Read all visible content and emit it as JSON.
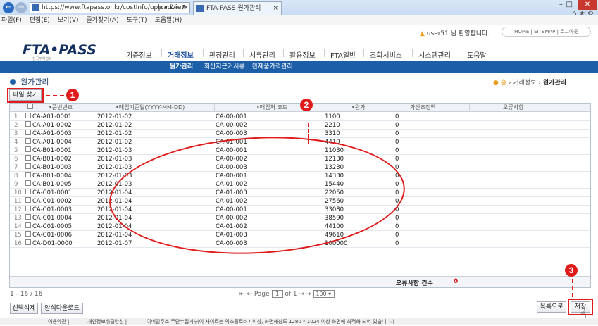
{
  "browser": {
    "url": "https://www.ftapass.or.kr/costInfo/uploadView",
    "url_icons": "ρ ▾ ▴ ≡ ↻",
    "tab_title": "FTA-PASS 원가관리",
    "tab_close": "×",
    "minimize": "–",
    "maximize": "□",
    "close": "✕",
    "toolbar_icons": "⌂ ★ ⚙",
    "back": "←",
    "forward": "→"
  },
  "menubar": [
    "파일(F)",
    "편집(E)",
    "보기(V)",
    "즐겨찾기(A)",
    "도구(T)",
    "도움말(H)"
  ],
  "header": {
    "logo": "FTA•PASS",
    "logo_sub": "한국무역협회",
    "welcome": "user51 님 환영합니다.",
    "welcome_dot": "▲",
    "toplinks": "HOME  |  SITEMAP  |  로그아웃"
  },
  "mainnav": [
    "기준정보",
    "거래정보",
    "판정관리",
    "서류관리",
    "활용정보",
    "FTA일반",
    "조회서비스",
    "시스템관리",
    "도움말"
  ],
  "subnav": [
    "원가관리",
    "· 회산지근거서류",
    "· 완제품가격관리"
  ],
  "page": {
    "title": "원가관리",
    "breadcrumb_home": "● 홈",
    "breadcrumb_mid": " › 거래정보 › ",
    "breadcrumb_current": "원가관리",
    "file_button": "파일 찾기"
  },
  "grid": {
    "headers": [
      "•품번번호",
      "•매입기준일(YYYY-MM-DD)",
      "•매입처 코드",
      "•원가",
      "가산조정액",
      "오류사항"
    ],
    "rows": [
      {
        "n": "1",
        "code": "CA-A01-0001",
        "date": "2012-01-02",
        "vendor": "CA-00-001",
        "cost": "1100",
        "adj": "0"
      },
      {
        "n": "2",
        "code": "CA-A01-0002",
        "date": "2012-01-02",
        "vendor": "CA-00-002",
        "cost": "2210",
        "adj": "0"
      },
      {
        "n": "3",
        "code": "CA-A01-0003",
        "date": "2012-01-02",
        "vendor": "CA-00-003",
        "cost": "3310",
        "adj": "0"
      },
      {
        "n": "4",
        "code": "CA-A01-0004",
        "date": "2012-01-02",
        "vendor": "CA-01-001",
        "cost": "4410",
        "adj": "0"
      },
      {
        "n": "5",
        "code": "CA-B01-0001",
        "date": "2012-01-03",
        "vendor": "CA-00-001",
        "cost": "11030",
        "adj": "0"
      },
      {
        "n": "6",
        "code": "CA-B01-0002",
        "date": "2012-01-03",
        "vendor": "CA-00-002",
        "cost": "12130",
        "adj": "0"
      },
      {
        "n": "7",
        "code": "CA-B01-0003",
        "date": "2012-01-03",
        "vendor": "CA-00-003",
        "cost": "13230",
        "adj": "0"
      },
      {
        "n": "8",
        "code": "CA-B01-0004",
        "date": "2012-01-03",
        "vendor": "CA-00-001",
        "cost": "14330",
        "adj": "0"
      },
      {
        "n": "9",
        "code": "CA-B01-0005",
        "date": "2012-01-03",
        "vendor": "CA-01-002",
        "cost": "15440",
        "adj": "0"
      },
      {
        "n": "10",
        "code": "CA-C01-0001",
        "date": "2012-01-04",
        "vendor": "CA-01-003",
        "cost": "22050",
        "adj": "0"
      },
      {
        "n": "11",
        "code": "CA-C01-0002",
        "date": "2012-01-04",
        "vendor": "CA-01-002",
        "cost": "27560",
        "adj": "0"
      },
      {
        "n": "12",
        "code": "CA-C01-0003",
        "date": "2012-01-04",
        "vendor": "CA-00-001",
        "cost": "33080",
        "adj": "0"
      },
      {
        "n": "13",
        "code": "CA-C01-0004",
        "date": "2012-01-04",
        "vendor": "CA-00-002",
        "cost": "38590",
        "adj": "0"
      },
      {
        "n": "14",
        "code": "CA-C01-0005",
        "date": "2012-01-04",
        "vendor": "CA-01-002",
        "cost": "44100",
        "adj": "0"
      },
      {
        "n": "15",
        "code": "CA-C01-0006",
        "date": "2012-01-04",
        "vendor": "CA-01-003",
        "cost": "49610",
        "adj": "0"
      },
      {
        "n": "16",
        "code": "CA-D01-0000",
        "date": "2012-01-07",
        "vendor": "CA-00-003",
        "cost": "100000",
        "adj": "0"
      }
    ],
    "error_count_label": "오류사항 건수",
    "error_count": "0"
  },
  "pager": {
    "range": "1 - 16 / 16",
    "prev_arrows": "⇤ ←",
    "page_label": "Page",
    "page_value": "1",
    "of_label": "of 1",
    "next_arrows": "→ ⇥",
    "page_size": "100 ▾"
  },
  "buttons": {
    "delete_selected": "선택삭제",
    "download_template": "양식다운로드",
    "back_to_list": "목록으로",
    "save": "저장"
  },
  "footer": {
    "terms": "이용약관  |",
    "privacy": "개인정보취급방침  |",
    "email": "이메일주소 무단수집거부",
    "notice": "(이 사이트는 익스플로러7 이상, 화면해상도 1280 * 1024 이상 화면에 최적화 되어 있습니다.)"
  },
  "annotations": [
    "1",
    "2",
    "3"
  ],
  "colors": {
    "accent": "#1d5ea8",
    "annotation": "#e01b1b",
    "error": "#d21f1f"
  }
}
